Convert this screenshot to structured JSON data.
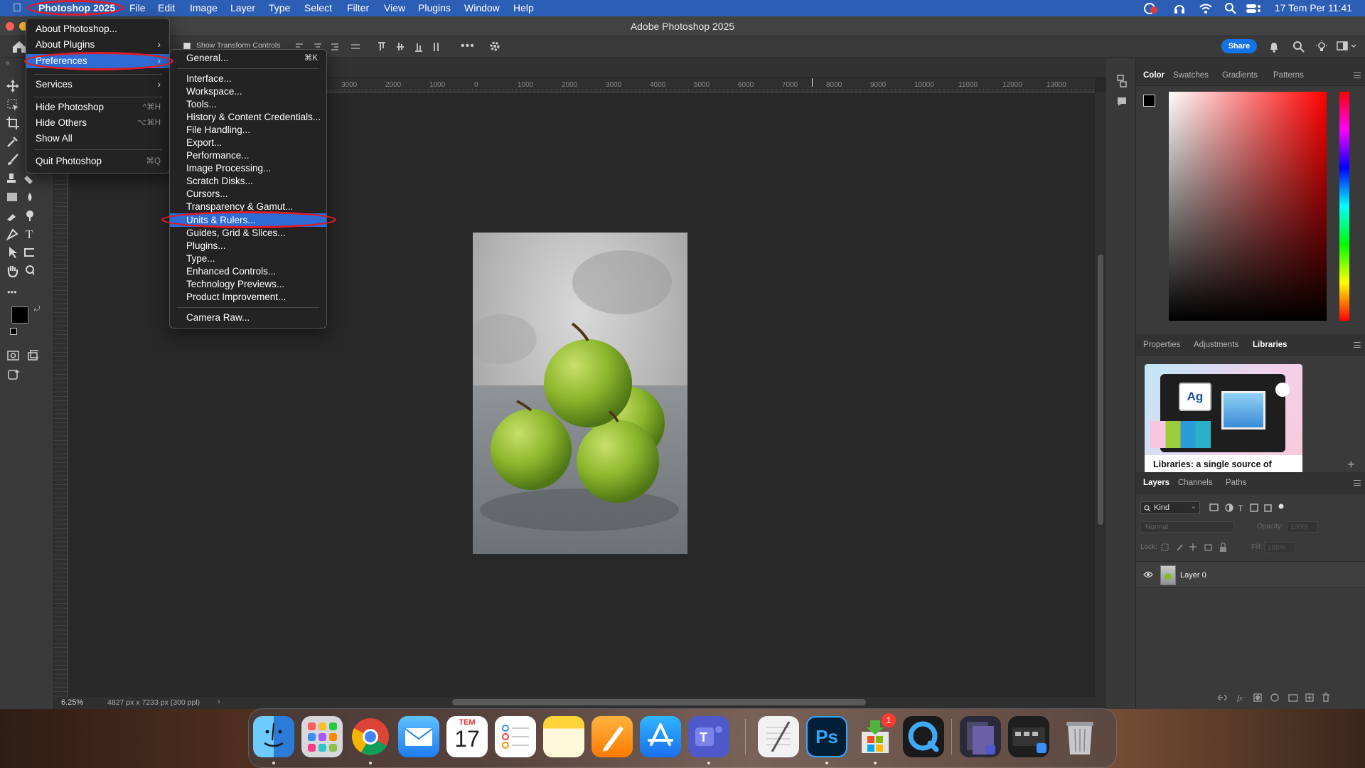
{
  "menubar": {
    "app": "Photoshop 2025",
    "items": [
      "File",
      "Edit",
      "Image",
      "Layer",
      "Type",
      "Select",
      "Filter",
      "View",
      "Plugins",
      "Window",
      "Help"
    ],
    "clock": "17 Tem Per  11:41"
  },
  "window": {
    "title": "Adobe Photoshop 2025"
  },
  "options_bar": {
    "show_transform_controls": "Show Transform Controls",
    "share": "Share"
  },
  "ruler": {
    "labels": [
      "3000",
      "2000",
      "1000",
      "0",
      "1000",
      "2000",
      "3000",
      "4000",
      "5000",
      "6000",
      "7000",
      "8000",
      "9000",
      "10000",
      "11000",
      "12000",
      "13000"
    ]
  },
  "status": {
    "zoom": "6.25%",
    "doc_info": "4827 px x 7233 px (300 ppl)"
  },
  "app_menu": {
    "items": [
      {
        "label": "About Photoshop...",
        "shortcut": ""
      },
      {
        "label": "About Plugins",
        "shortcut": ""
      },
      {
        "label": "Preferences",
        "shortcut": ""
      },
      {
        "label": "Services",
        "shortcut": ""
      },
      {
        "label": "Hide Photoshop",
        "shortcut": "^⌘H"
      },
      {
        "label": "Hide Others",
        "shortcut": "⌥⌘H"
      },
      {
        "label": "Show All",
        "shortcut": ""
      },
      {
        "label": "Quit Photoshop",
        "shortcut": "⌘Q"
      }
    ]
  },
  "prefs_menu": {
    "items": [
      {
        "label": "General...",
        "shortcut": "⌘K"
      },
      {
        "label": "Interface..."
      },
      {
        "label": "Workspace..."
      },
      {
        "label": "Tools..."
      },
      {
        "label": "History & Content Credentials..."
      },
      {
        "label": "File Handling..."
      },
      {
        "label": "Export..."
      },
      {
        "label": "Performance..."
      },
      {
        "label": "Image Processing..."
      },
      {
        "label": "Scratch Disks..."
      },
      {
        "label": "Cursors..."
      },
      {
        "label": "Transparency & Gamut..."
      },
      {
        "label": "Units & Rulers..."
      },
      {
        "label": "Guides, Grid & Slices..."
      },
      {
        "label": "Plugins..."
      },
      {
        "label": "Type..."
      },
      {
        "label": "Enhanced Controls..."
      },
      {
        "label": "Technology Previews..."
      },
      {
        "label": "Product Improvement..."
      },
      {
        "label": "Camera Raw..."
      }
    ],
    "highlighted": "Units & Rulers..."
  },
  "panels": {
    "color_tabs": [
      "Color",
      "Swatches",
      "Gradients",
      "Patterns"
    ],
    "props_tabs": [
      "Properties",
      "Adjustments",
      "Libraries"
    ],
    "libraries_caption": "Libraries: a single source of",
    "libraries_tile_text": "Ag",
    "layers_tabs": [
      "Layers",
      "Channels",
      "Paths"
    ],
    "kind": "Kind",
    "blend_mode": "Normal",
    "opacity_label": "Opacity:",
    "opacity_value": "100%",
    "lock_label": "Lock:",
    "fill_label": "Fill:",
    "fill_value": "100%",
    "layer_name": "Layer 0"
  },
  "dock": {
    "calendar_month": "TEM",
    "calendar_day": "17",
    "ps_label": "Ps",
    "badge": "1"
  },
  "colors": {
    "accent": "#2e6bd5",
    "menubar": "#2d5eb5",
    "annotation": "#e01b24",
    "share": "#1473e6"
  }
}
